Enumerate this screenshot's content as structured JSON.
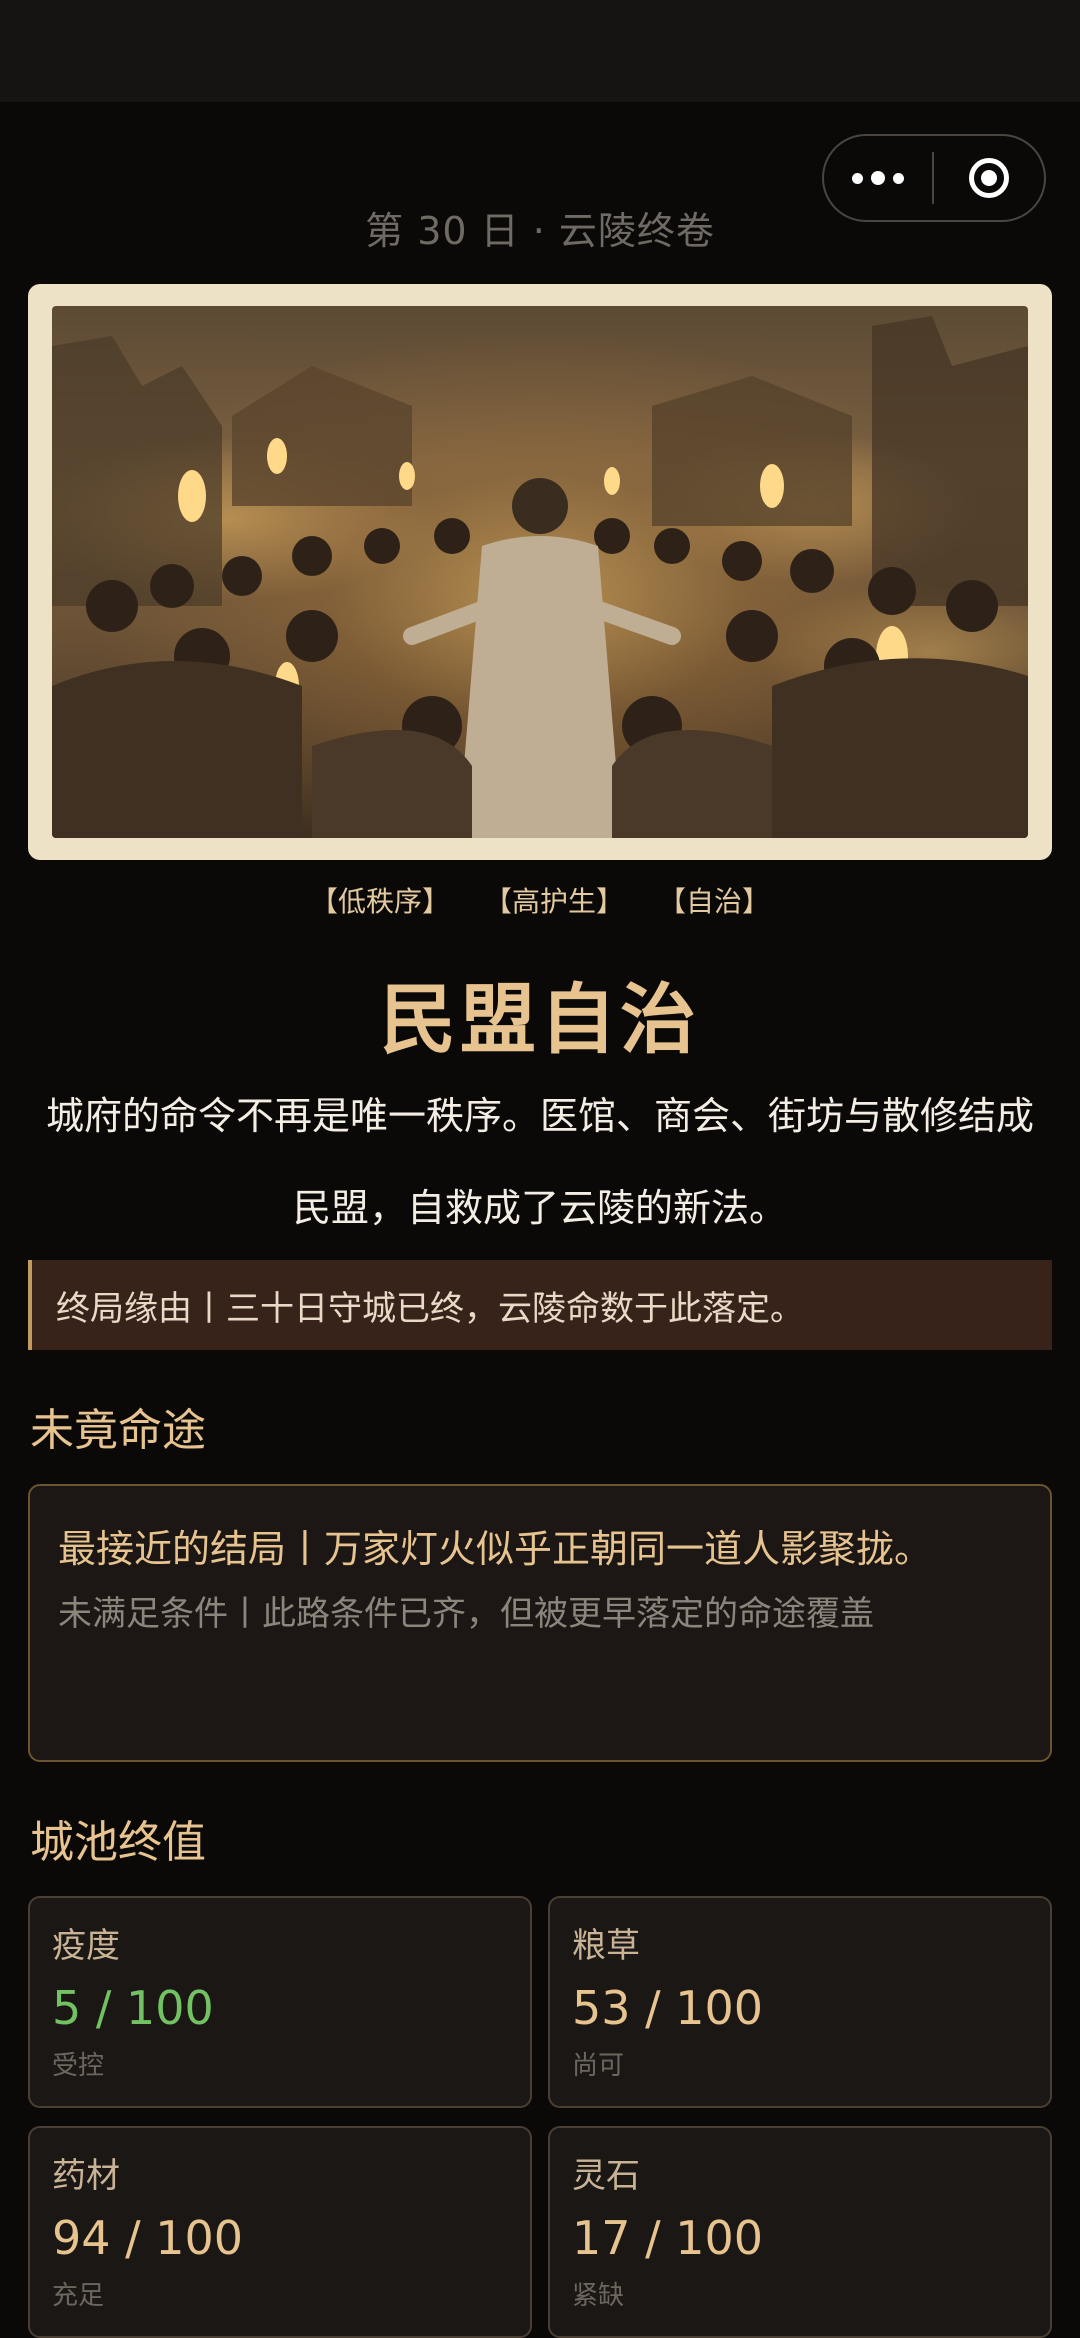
{
  "header": {
    "day_title": "第 30 日 · 云陵终卷"
  },
  "capsule": {
    "more_icon": "more-dots-icon",
    "close_icon": "target-close-icon"
  },
  "hero": {
    "image_icon": "crowd-torches-illustration"
  },
  "tags": [
    "【低秩序】",
    "【高护生】",
    "【自治】"
  ],
  "ending": {
    "title": "民盟自治",
    "description": "城府的命令不再是唯一秩序。医馆、商会、街坊与散修结成民盟，自救成了云陵的新法。",
    "reason": "终局缘由丨三十日守城已终，云陵命数于此落定。"
  },
  "unfinished": {
    "section_title": "未竟命途",
    "closest": "最接近的结局丨万家灯火似乎正朝同一道人影聚拢。",
    "unmet": "未满足条件丨此路条件已齐，但被更早落定的命途覆盖"
  },
  "city_stats": {
    "section_title": "城池终值",
    "items": [
      {
        "label": "疫度",
        "value": "5 / 100",
        "state": "受控",
        "color": "#72c264"
      },
      {
        "label": "粮草",
        "value": "53 / 100",
        "state": "尚可",
        "color": "#e6c38f"
      },
      {
        "label": "药材",
        "value": "94 / 100",
        "state": "充足",
        "color": "#e6c38f"
      },
      {
        "label": "灵石",
        "value": "17 / 100",
        "state": "紧缺",
        "color": "#e6c38f"
      }
    ]
  }
}
